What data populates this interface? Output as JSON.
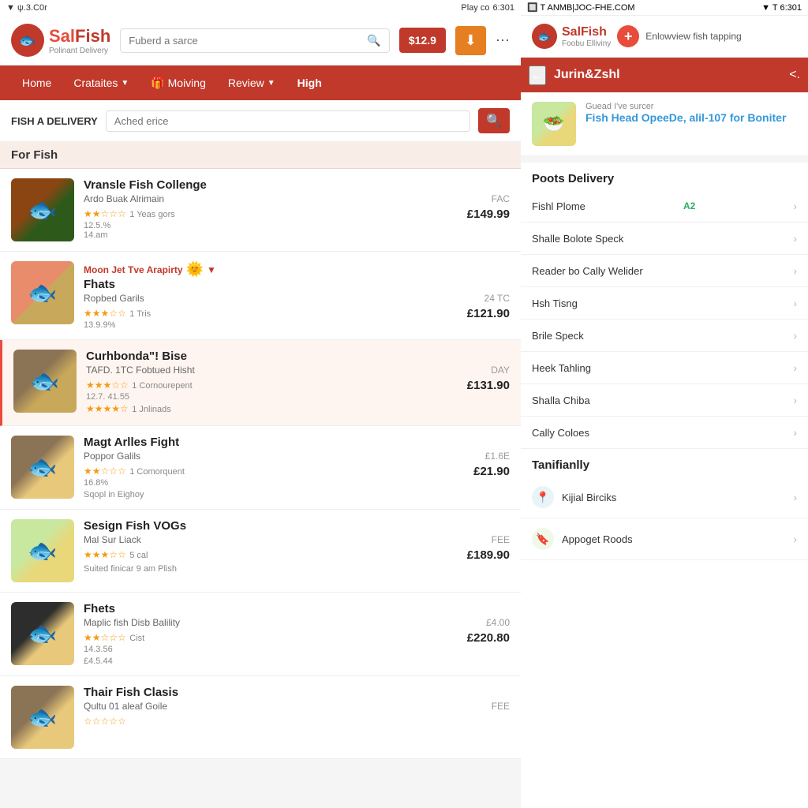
{
  "left_status_bar": {
    "signal": "▼ ψ.3.C0r",
    "play": "Play co",
    "time": "6:301"
  },
  "right_status_bar": {
    "url": "ANMB|JOC-FHE.COM",
    "signal": "▼ T",
    "time": "6:301"
  },
  "left": {
    "header": {
      "logo_letter": "🐟",
      "logo_title_sal": "Sal",
      "logo_title_fish": "Fish",
      "logo_subtitle": "Polinant Delivery",
      "search_placeholder": "Fuberd a sarce",
      "price": "$12.9"
    },
    "nav": {
      "items": [
        {
          "label": "Home",
          "has_dropdown": false
        },
        {
          "label": "Crataites",
          "has_dropdown": true
        },
        {
          "label": "🎁 Moiving",
          "has_dropdown": false
        },
        {
          "label": "Review",
          "has_dropdown": true
        },
        {
          "label": "High",
          "has_dropdown": false
        }
      ]
    },
    "search_section": {
      "label": "FISH A DELIVERY",
      "placeholder": "Ached erice"
    },
    "category": "For Fish",
    "listings": [
      {
        "id": 1,
        "title": "Vransle Fish Collenge",
        "subtitle": "Ardo Buak Alrimain",
        "code": "FAC",
        "rating_stars": 2,
        "rating_text": "1 Yeas gors",
        "rating_pct": "12.5.%",
        "time": "14.am",
        "price": "£149.99",
        "img_class": "img1",
        "highlighted": false
      },
      {
        "id": 2,
        "title": "Fhats",
        "subtitle": "Ropbed Garils",
        "code": "24 TC",
        "rating_stars": 3,
        "rating_text": "1 Tris",
        "rating_pct": "13.9.9%",
        "time": "",
        "price": "£121.90",
        "img_class": "img2",
        "highlighted": false,
        "promo": "Moon Jet Tve Arapirty"
      },
      {
        "id": 3,
        "title": "Curhbonda\"! Bise",
        "subtitle": "TAFD. 1TC Fobtued Hisht",
        "code": "DAY",
        "rating_stars": 3,
        "rating_text": "1 Cornourepent",
        "rating_pct": "12.7. 41.55",
        "extra_rating": "1 Jnlinads",
        "price": "£131.90",
        "img_class": "img3",
        "highlighted": true
      },
      {
        "id": 4,
        "title": "Magt Arlles Fight",
        "subtitle": "Poppor Galils",
        "code": "£1.6E",
        "rating_stars": 2,
        "rating_text": "1 Comorquent",
        "rating_pct": "16.8%",
        "time": "Sqopl in Eighoy",
        "price": "£21.90",
        "img_class": "img4",
        "highlighted": false
      },
      {
        "id": 5,
        "title": "Sesign Fish VOGs",
        "subtitle": "Mal Sur Liack",
        "code": "FEE",
        "rating_stars": 3,
        "rating_text": "5 cal",
        "rating_pct": "",
        "time": "Suited finicar 9 am Plish",
        "price": "£189.90",
        "img_class": "img5",
        "highlighted": false
      },
      {
        "id": 6,
        "title": "Fhets",
        "subtitle": "Maplic fish Disb Balility",
        "code": "£4.00",
        "rating_stars": 2,
        "rating_text": "Cist",
        "rating_pct": "14.3.56",
        "time": "£4.5.44",
        "price": "£220.80",
        "img_class": "img6",
        "highlighted": false
      },
      {
        "id": 7,
        "title": "Thair Fish Clasis",
        "subtitle": "Qultu 01 aleaf Goile",
        "code": "FEE",
        "rating_stars": 0,
        "rating_text": "",
        "rating_pct": "",
        "time": "",
        "price": "",
        "img_class": "img7",
        "highlighted": false
      }
    ]
  },
  "right": {
    "header": {
      "logo_letter": "🐟",
      "logo_title": "SalFish",
      "logo_subtitle": "Foobu Elliviny",
      "tagline": "Enlowview fish tapping"
    },
    "nav": {
      "back_label": "←",
      "title": "Jurin&Zshl",
      "share_label": "<."
    },
    "product": {
      "label": "Guead I've surcer",
      "name": "Fish Head OpeeDe, alil-107 for Boniter"
    },
    "delivery": {
      "heading": "Poots Delivery",
      "items": [
        {
          "label": "Fishl Plome",
          "badge": "A2",
          "has_arrow": true
        },
        {
          "label": "Shalle Bolote Speck",
          "badge": "",
          "has_arrow": true
        },
        {
          "label": "Reader bo Cally Welider",
          "badge": "",
          "has_arrow": true
        },
        {
          "label": "Hsh Tisng",
          "badge": "",
          "has_arrow": true
        },
        {
          "label": "Brile Speck",
          "badge": "",
          "has_arrow": true
        },
        {
          "label": "Heek Tahling",
          "badge": "",
          "has_arrow": true
        },
        {
          "label": "Shalla Chiba",
          "badge": "",
          "has_arrow": true
        },
        {
          "label": "Cally Coloes",
          "badge": "",
          "has_arrow": true
        }
      ]
    },
    "tanifianlly": {
      "heading": "Tanifianlly",
      "items": [
        {
          "label": "Kijial Birciks",
          "icon_type": "location",
          "has_arrow": true
        },
        {
          "label": "Appoget Roods",
          "icon_type": "bookmark",
          "has_arrow": true
        }
      ]
    }
  }
}
